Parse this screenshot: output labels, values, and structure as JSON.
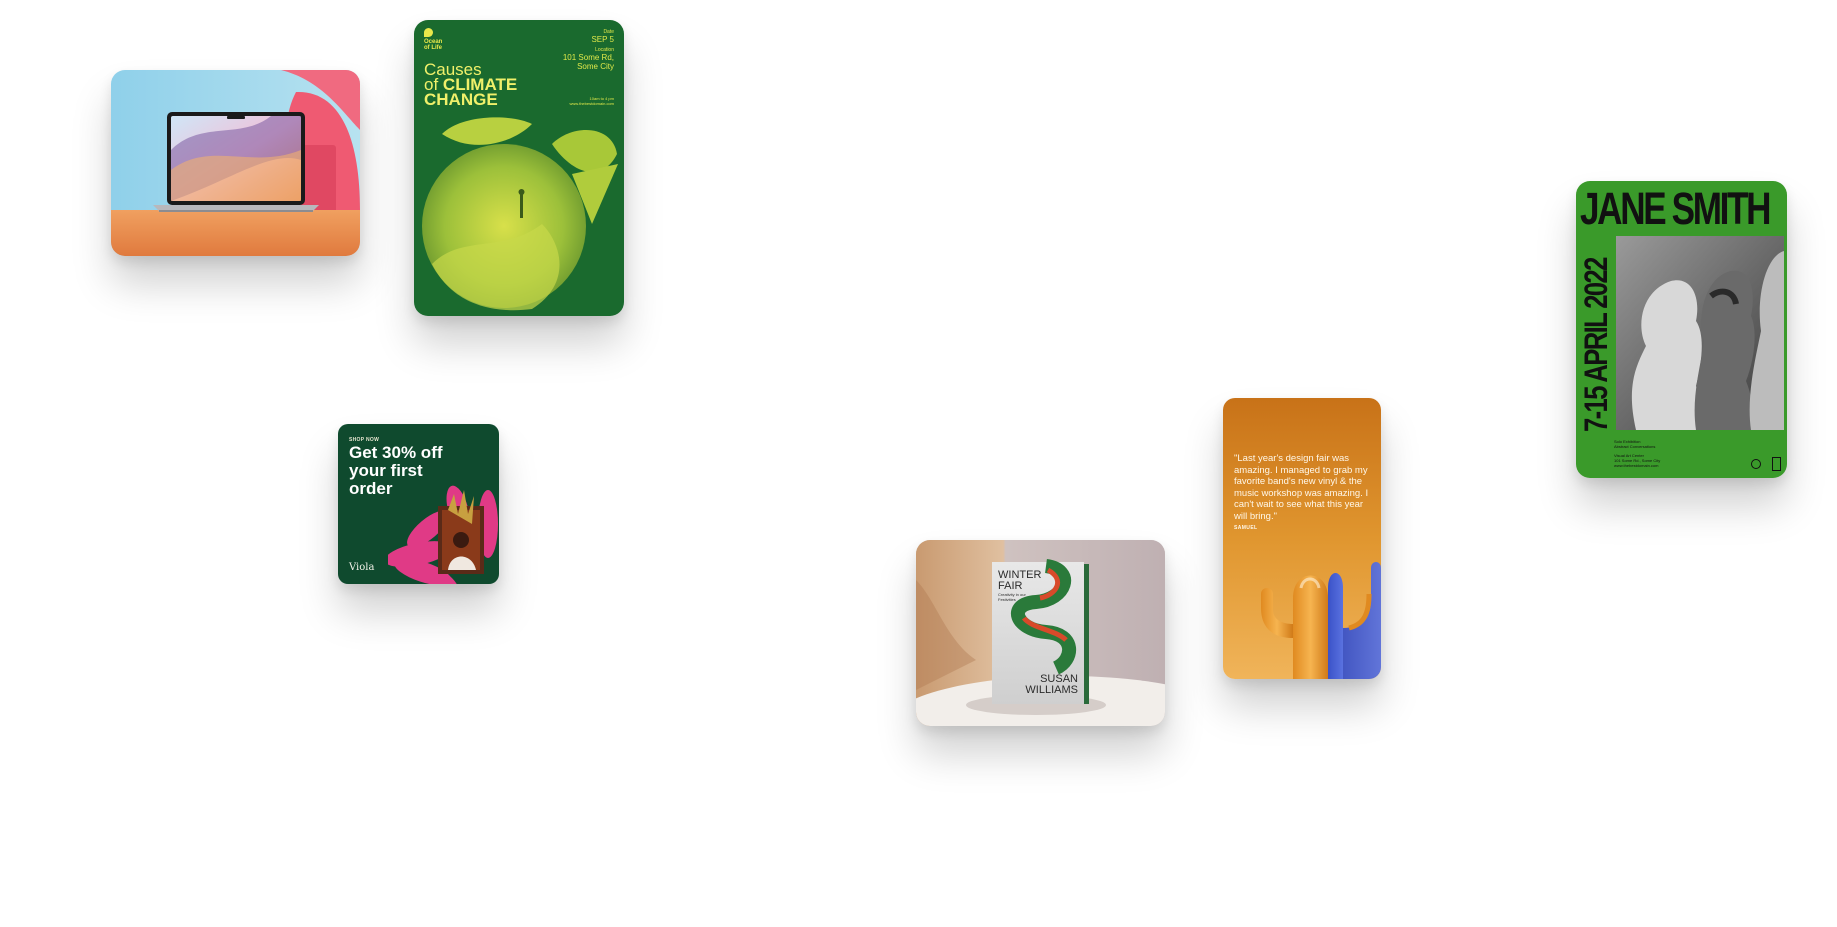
{
  "climate_poster": {
    "logo": [
      "Ocean",
      "of Life"
    ],
    "date_label": "Date",
    "date": "SEP 5",
    "location_label": "Location",
    "address_line1": "101 Some Rd,",
    "address_line2": "Some City",
    "time": "10am to 4 pm",
    "url": "www.thebestdomain.com",
    "title_line1": "Causes",
    "title_of": "of",
    "title_word": "CLIMATE",
    "title_line3": "CHANGE",
    "colors": {
      "background": "#1a6a2e",
      "accent": "#e8e84a"
    }
  },
  "jane_poster": {
    "title": "JANE SMITH",
    "date": "7-15 APRIL 2022",
    "info_line1": "Solo Exhibition",
    "info_line2": "Abstract Conversations",
    "venue_line1": "Visual Art Center",
    "venue_line2": "101 Some Rd., Some City",
    "venue_line3": "www.thebestdomain.com",
    "colors": {
      "background": "#3a9a2a"
    }
  },
  "discount_card": {
    "eyebrow": "SHOP NOW",
    "headline": "Get 30% off your first order",
    "brand": "Viola",
    "colors": {
      "background": "#0f4a2e",
      "petals": "#e03a86"
    }
  },
  "book_card": {
    "title_line1": "WINTER",
    "title_line2": "FAIR",
    "subtitle_line1": "Creativity in our",
    "subtitle_line2": "Festivities",
    "author_line1": "SUSAN",
    "author_line2": "WILLIAMS"
  },
  "quote_card": {
    "quote": "\"Last year's design fair was amazing. I managed to grab my favorite band's new vinyl & the music workshop was amazing. I can't wait to see what this year will bring.\"",
    "author": "SAMUEL",
    "colors": {
      "top": "#c87218",
      "bottom": "#f0b45a"
    }
  }
}
